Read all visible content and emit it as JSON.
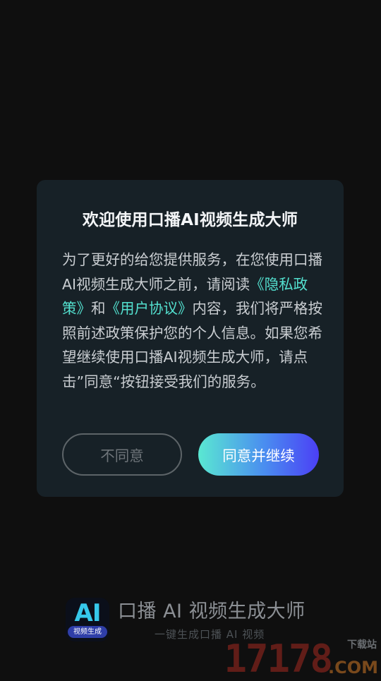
{
  "dialog": {
    "title": "欢迎使用口播AI视频生成大师",
    "body_intro": "为了更好的给您提供服务，在您使用口播AI视频生成大师之前，请阅读",
    "privacy_link": "《隐私政策》",
    "conjunction": "和",
    "agreement_link": "《用户协议》",
    "body_rest": "内容，我们将严格按照前述政策保护您的个人信息。如果您希望继续使用口播AI视频生成大师，请点击”同意“按钮接受我们的服务。",
    "decline_label": "不同意",
    "accept_label": "同意并继续"
  },
  "brand": {
    "logo_text": "AI",
    "logo_subtitle": "视频生成",
    "app_name": "口播 AI 视频生成大师",
    "slogan": "一键生成口播 AI 视频"
  },
  "watermark": {
    "number": "17178",
    "tag": "下载站",
    "domain": ".COM"
  },
  "colors": {
    "background": "#0f0f0f",
    "dialog_background": "#172127",
    "link": "#53e0cf",
    "accept_gradient_start": "#5ae8d2",
    "accept_gradient_end": "#4b3ff5"
  }
}
